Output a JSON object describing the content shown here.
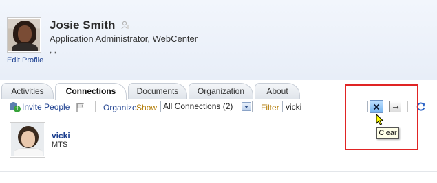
{
  "profile": {
    "name": "Josie Smith",
    "title": "Application Administrator, WebCenter",
    "extra": ", ,",
    "edit_label": "Edit Profile"
  },
  "tabs": [
    {
      "label": "Activities",
      "active": false
    },
    {
      "label": "Connections",
      "active": true
    },
    {
      "label": "Documents",
      "active": false
    },
    {
      "label": "Organization",
      "active": false
    },
    {
      "label": "About",
      "active": false
    }
  ],
  "toolbar": {
    "invite_label": "Invite People",
    "organize_label": "Organize",
    "show_label": "Show",
    "show_value": "All Connections (2)",
    "filter_label": "Filter",
    "filter_value": "vicki",
    "tooltip": "Clear"
  },
  "connections": [
    {
      "name": "vicki",
      "role": "MTS"
    }
  ],
  "colors": {
    "accent_link": "#1c3f8f",
    "highlight": "#e02424",
    "label_gold": "#b07800"
  },
  "icons": [
    "presence-icon",
    "invite-people-icon",
    "flag-icon",
    "clear-icon",
    "go-arrow-icon",
    "refresh-icon",
    "pointer-cursor-icon"
  ]
}
